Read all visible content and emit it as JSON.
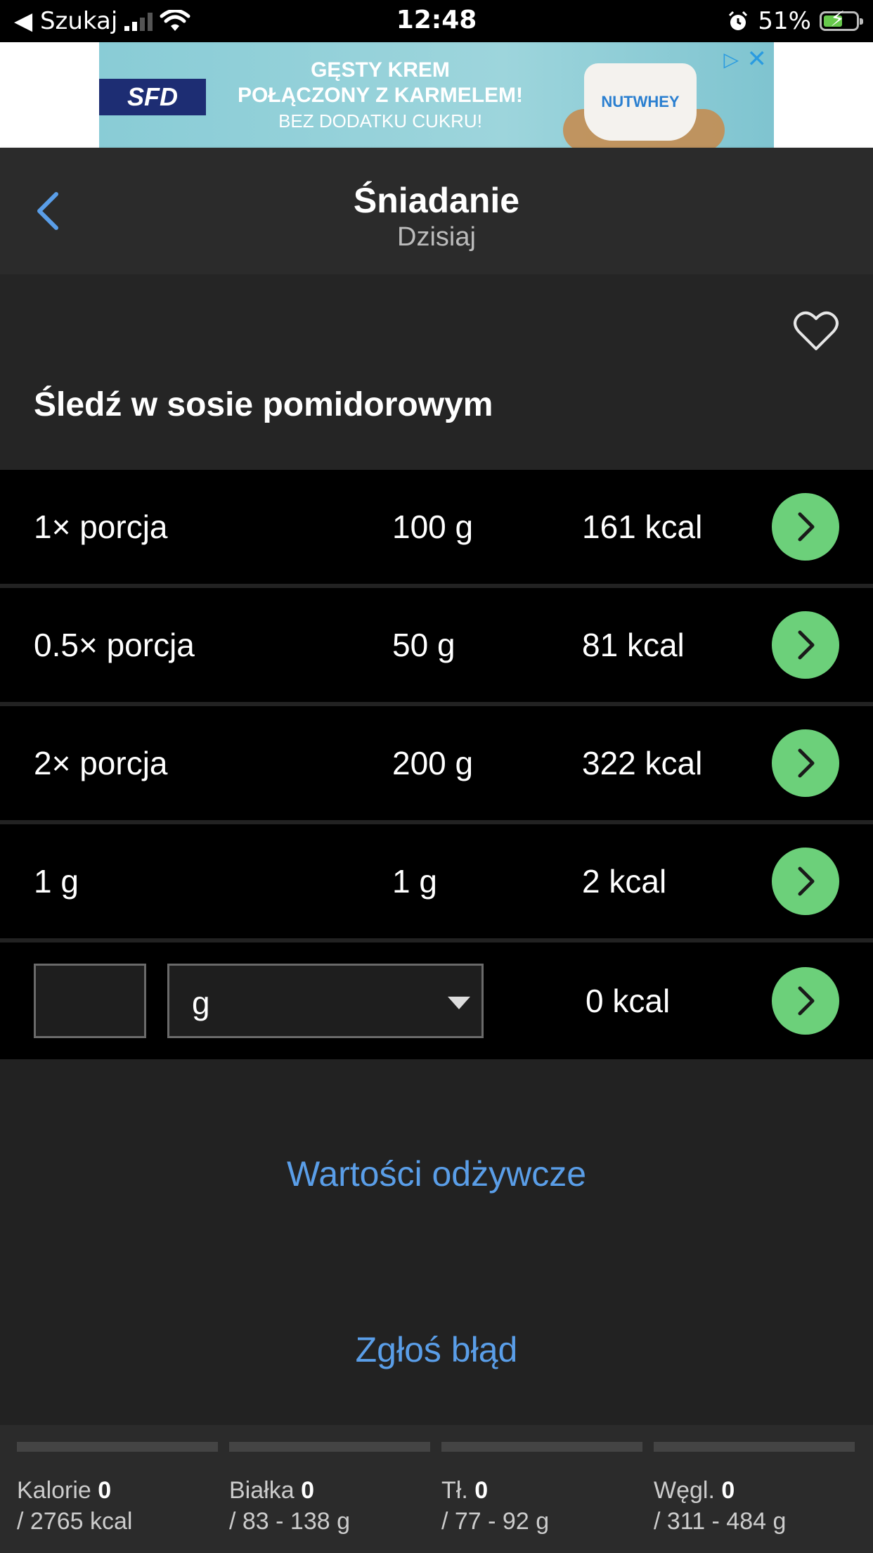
{
  "status_bar": {
    "back_app": "◀ Szukaj",
    "time": "12:48",
    "battery": "51%"
  },
  "ad": {
    "logo": "SFD",
    "line1": "GĘSTY KREM",
    "line2": "POŁĄCZONY Z KARMELEM!",
    "line3": "BEZ DODATKU CUKRU!",
    "product": "NUTWHEY"
  },
  "header": {
    "title": "Śniadanie",
    "subtitle": "Dzisiaj"
  },
  "product": {
    "name": "Śledź w sosie pomidorowym"
  },
  "portions": [
    {
      "label": "1× porcja",
      "weight": "100 g",
      "kcal": "161 kcal"
    },
    {
      "label": "0.5× porcja",
      "weight": "50 g",
      "kcal": "81 kcal"
    },
    {
      "label": "2× porcja",
      "weight": "200 g",
      "kcal": "322 kcal"
    },
    {
      "label": "1 g",
      "weight": "1 g",
      "kcal": "2 kcal"
    }
  ],
  "custom": {
    "quantity": "",
    "unit": "g",
    "kcal": "0 kcal"
  },
  "links": {
    "nutrition": "Wartości odżywcze",
    "report": "Zgłoś błąd"
  },
  "macros": [
    {
      "name": "Kalorie",
      "value": "0",
      "target": "/ 2765 kcal",
      "progress": 0
    },
    {
      "name": "Białka",
      "value": "0",
      "target": "/ 83 - 138 g",
      "progress": 0
    },
    {
      "name": "Tł.",
      "value": "0",
      "target": "/ 77 - 92 g",
      "progress": 0
    },
    {
      "name": "Węgl.",
      "value": "0",
      "target": "/ 311 - 484 g",
      "progress": 0
    }
  ],
  "colors": {
    "accent_green": "#6cd07a",
    "link_blue": "#5a9ee8"
  }
}
